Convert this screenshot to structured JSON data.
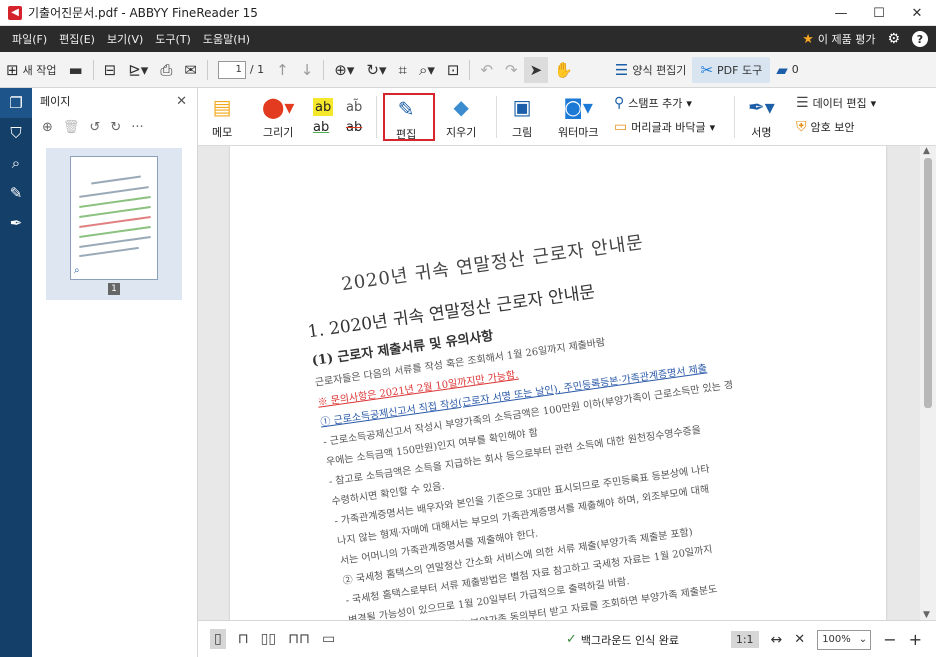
{
  "window": {
    "title": "기출어진문서.pdf - ABBYY FineReader 15",
    "controls": [
      "—",
      "☐",
      "✕"
    ]
  },
  "menu": {
    "items": [
      "파일(F)",
      "편집(E)",
      "보기(V)",
      "도구(T)",
      "도움말(H)"
    ],
    "rate_label": "이 제품 평가"
  },
  "toolbar": {
    "new_task": "새 작업",
    "page_current": "1",
    "page_total": "/ 1",
    "form_editor": "양식 편집기",
    "pdf_tools": "PDF 도구",
    "comment_count": "0"
  },
  "pages_panel": {
    "title": "페이지",
    "page_number": "1"
  },
  "ribbon": {
    "memo": "메모",
    "draw": "그리기",
    "edit": "편집",
    "erase": "지우기",
    "image": "그림",
    "watermark": "워터마크",
    "stamp_add": "스탬프 추가",
    "header_footer": "머리글과 바닥글",
    "signature": "서명",
    "data_edit": "데이터 편집",
    "password": "암호 보안"
  },
  "document": {
    "title": "2020년 귀속 연말정산 근로자 안내문",
    "h1": "1. 2020년 귀속 연말정산 근로자 안내문",
    "h2": "(1) 근로자 제출서류 및 유의사항",
    "h2_deadline": "1월 26일까지 제출",
    "lines": [
      "근로자들은 다음의 서류를 작성 혹은 조회해서 1월 26일까지 제출바람",
      "※ 문의사항은 2021년 2월 10일까지만 가능함.",
      "① 근로소득공제신고서 직접 작성(근로자 서명 또는 날인), 주민등록등본·가족관계증명서 제출",
      "- 근로소득공제신고서 작성시 부양가족의 소득금액은 100만원 이하(부양가족이 근로소득만 있는 경",
      "우에는 소득금액 150만원)인지 여부를 확인해야 함",
      "- 참고로 소득금액은 소득을 지급하는 회사 등으로부터 관련 소득에 대한 원천징수영수증을",
      "수령하시면 확인할 수 있음.",
      "- 가족관계증명서는 배우자와 본인을 기준으로 3대만 표시되므로 주민등록표 등본상에 나타",
      "나지 않는 형제·자매에 대해서는 부모의 가족관계증명서를 제출해야 하며, 외조부모에 대해",
      "서는 어머니의 가족관계증명서를 제출해야 한다.",
      "② 국세청 홈택스의 연말정산 간소화 서비스에 의한 서류 제출(부양가족 제출분 포함)",
      "- 국세청 홈택스로부터 서류 제출방법은 별첨 자료 참고하고 국세청 자료는 1월 20일까지",
      "변경될 가능성이 있으므로 1월 20일부터 가급적으로 출력하길 바람.",
      "- 부양가족 서류가 있는 경우 부양가족 동의부터 받고 자료를 조회하면 부양가족 제출분도"
    ]
  },
  "statusbar": {
    "background_status": "백그라운드 인식 완료",
    "ratio": "1:1",
    "zoom": "100%"
  }
}
